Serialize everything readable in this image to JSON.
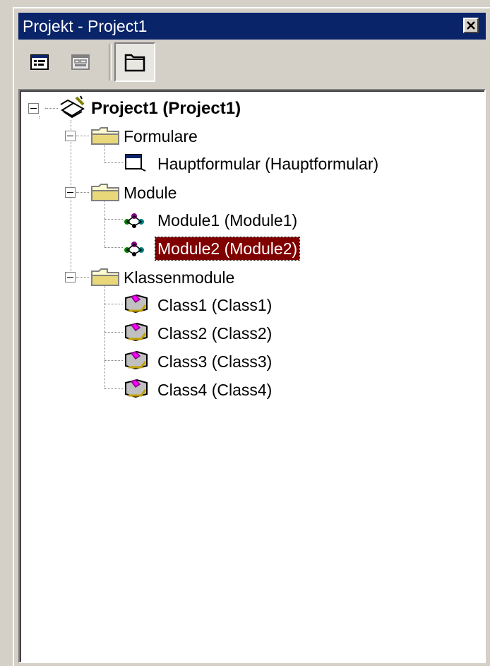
{
  "window": {
    "title": "Projekt - Project1",
    "close_symbol": "✕"
  },
  "toolbar": {
    "buttons": [
      {
        "name": "view-code-icon"
      },
      {
        "name": "view-object-icon"
      },
      {
        "name": "toggle-folders-icon"
      }
    ]
  },
  "tree": {
    "root": "Project1 (Project1)",
    "groups": [
      {
        "label": "Formulare",
        "items": [
          "Hauptformular (Hauptformular)"
        ]
      },
      {
        "label": "Module",
        "items": [
          "Module1 (Module1)",
          "Module2 (Module2)"
        ],
        "selected": "Module2 (Module2)"
      },
      {
        "label": "Klassenmodule",
        "items": [
          "Class1 (Class1)",
          "Class2 (Class2)",
          "Class3 (Class3)",
          "Class4 (Class4)"
        ]
      }
    ]
  },
  "colors": {
    "titlebar": "#0a246a",
    "selection": "#800000",
    "face": "#d4d0c8"
  }
}
